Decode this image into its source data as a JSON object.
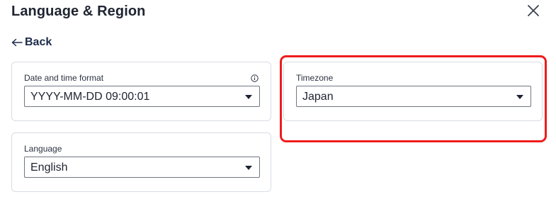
{
  "header": {
    "title": "Language & Region",
    "close_icon": "close-icon"
  },
  "nav": {
    "back_label": "Back",
    "back_icon": "arrow-left-icon"
  },
  "settings": {
    "datetime_format": {
      "label": "Date and time format",
      "value": "YYYY-MM-DD 09:00:01",
      "info_icon": "info-icon"
    },
    "language": {
      "label": "Language",
      "value": "English"
    },
    "timezone": {
      "label": "Timezone",
      "value": "Japan"
    }
  },
  "annotation": {
    "highlight_color": "#ee1c1c",
    "highlighted": "timezone"
  }
}
